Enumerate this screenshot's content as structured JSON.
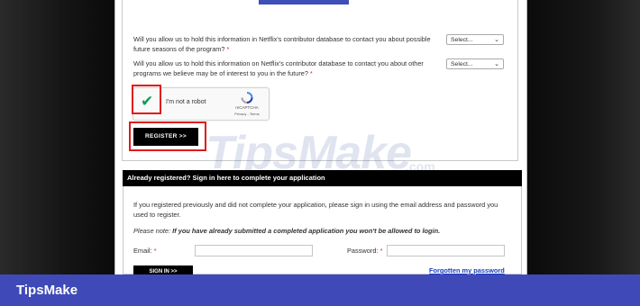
{
  "form": {
    "question1": "Will you allow us to hold this information in Netflix's contributor database to contact you about possible future seasons of the program?",
    "question2": "Will you allow us to hold this information on Netflix's contributor database to contact you about other programs we believe may be of interest to you in the future?",
    "required_mark": "*",
    "select1_value": "Select...",
    "select2_value": "Select...",
    "register_label": "REGISTER >>"
  },
  "captcha": {
    "label": "I'm not a robot",
    "brand": "reCAPTCHA",
    "links": "Privacy - Terms"
  },
  "login": {
    "header": "Already registered? Sign in here to complete your application",
    "intro": "If you registered previously and did not complete your application, please sign in using the email address and password you used to register.",
    "note_label": "Please note:",
    "note_text": "If you have already submitted a completed application you won't be allowed to login.",
    "email_label": "Email:",
    "password_label": "Password:",
    "forgot_link": "Forgotten my password",
    "signin_label": "SIGN IN >>"
  },
  "watermark": {
    "text": "TipsMake",
    "suffix": ".com"
  },
  "footer": {
    "brand": "TipsMake"
  },
  "colors": {
    "highlight": "#e01b1b",
    "footer": "#3f4ab8",
    "link": "#1a3dbf"
  }
}
